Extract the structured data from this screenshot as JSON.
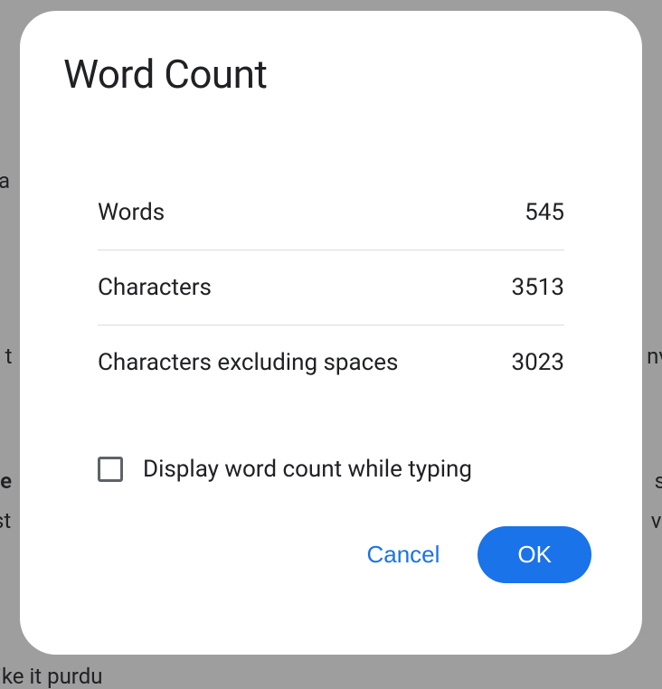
{
  "dialog": {
    "title": "Word Count",
    "stats": [
      {
        "label": "Words",
        "value": "545"
      },
      {
        "label": "Characters",
        "value": "3513"
      },
      {
        "label": "Characters excluding spaces",
        "value": "3023"
      }
    ],
    "checkbox": {
      "label": "Display word count while typing",
      "checked": false
    },
    "buttons": {
      "cancel": "Cancel",
      "ok": "OK"
    }
  },
  "background": {
    "frag1": "a",
    "frag2": "o t",
    "frag3": "nv",
    "frag4": "te",
    "frag5": "s",
    "frag6": "st",
    "frag7": "ve",
    "frag8": "ike it purdu"
  }
}
